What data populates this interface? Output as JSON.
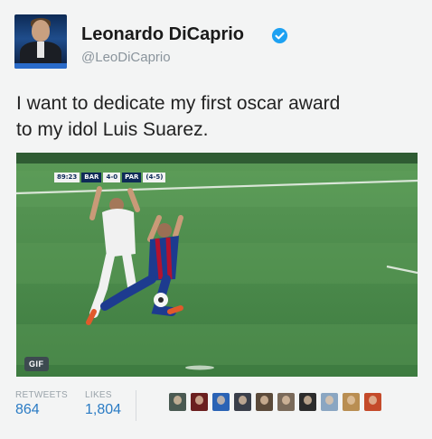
{
  "user": {
    "name": "Leonardo DiCaprio",
    "handle": "@LeoDiCaprio",
    "verified_icon": "verified-badge-icon",
    "verified_color": "#1da1f2"
  },
  "tweet": {
    "text_line1": "I want to dedicate my first oscar award",
    "text_line2": "to my idol Luis Suarez."
  },
  "media": {
    "badge": "GIF",
    "scoreboard": {
      "time": "89:23",
      "team1": "BAR",
      "score": "4-0",
      "team2": "PAR",
      "agg": "(4-5)"
    }
  },
  "stats": {
    "retweets_label": "RETWEETS",
    "retweets_value": "864",
    "likes_label": "LIKES",
    "likes_value": "1,804",
    "liker_avatar_count": 10
  },
  "colors": {
    "accent": "#2a7bc4",
    "pitch": "#3c7a3e",
    "barca_shirt": "#1d3b8f",
    "psg_shirt": "#f1f1f1"
  }
}
